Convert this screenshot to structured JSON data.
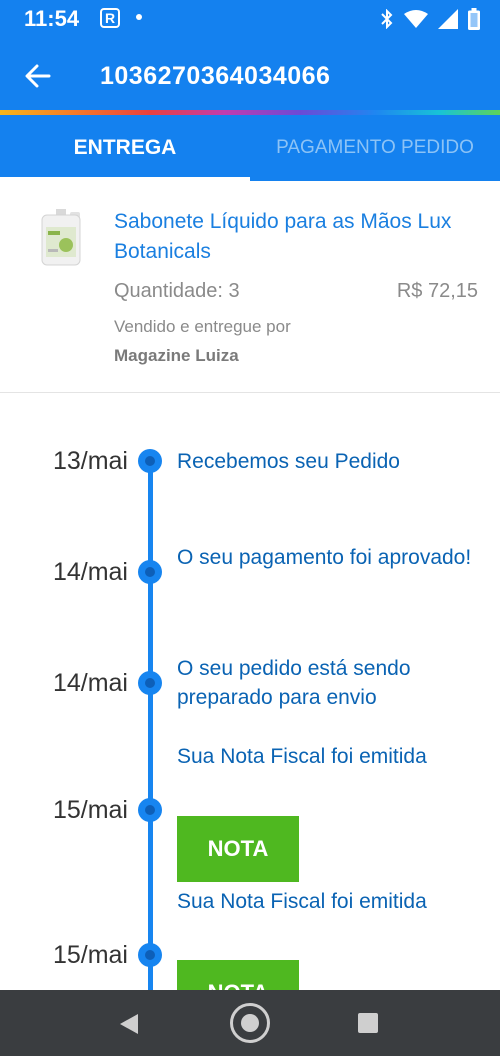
{
  "status_bar": {
    "time": "11:54",
    "notification_badge": "R"
  },
  "header": {
    "title": "1036270364034066"
  },
  "tabs": [
    {
      "label": "ENTREGA",
      "active": true
    },
    {
      "label": "PAGAMENTO PEDIDO",
      "active": false
    }
  ],
  "product": {
    "name": "Sabonete Líquido para as Mãos Lux Botanicals",
    "quantity": "Quantidade: 3",
    "price": "R$ 72,15",
    "sold_by_label": "Vendido e entregue por",
    "seller": "Magazine Luiza"
  },
  "timeline": [
    {
      "date": "13/mai",
      "text": "Recebemos seu Pedido"
    },
    {
      "date": "14/mai",
      "text": "O seu pagamento foi aprovado!"
    },
    {
      "date": "14/mai",
      "text": "O seu pedido está sendo preparado para envio"
    },
    {
      "date": "15/mai",
      "text": "Sua Nota Fiscal foi emitida",
      "button": "NOTA"
    },
    {
      "date": "15/mai",
      "text": "Sua Nota Fiscal foi emitida",
      "button": "NOTA"
    }
  ],
  "colors": {
    "primary": "#1481ef",
    "accent_green": "#4fb820",
    "timeline_text": "#0a63b3"
  },
  "icons": [
    "back-arrow-icon",
    "bluetooth-icon",
    "wifi-icon",
    "signal-icon",
    "battery-icon",
    "nav-back-icon",
    "nav-home-icon",
    "nav-recent-icon"
  ]
}
